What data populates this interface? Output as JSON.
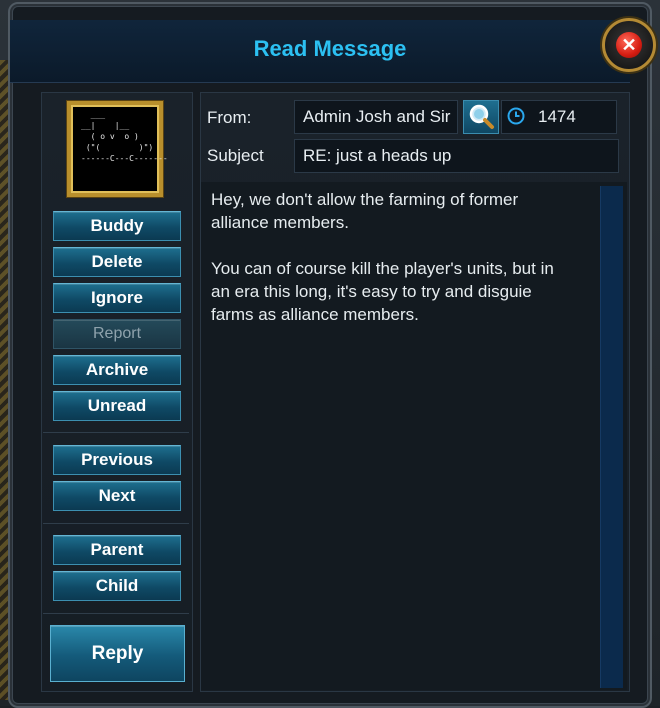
{
  "window": {
    "title": "Read Message"
  },
  "avatar": {
    "art": "  ___ \n__|    |__\n  ( o v  o )\n (\"(        )\")\n------C---C-------"
  },
  "actions": {
    "buddy": "Buddy",
    "delete": "Delete",
    "ignore": "Ignore",
    "report": "Report",
    "archive": "Archive",
    "unread": "Unread",
    "previous": "Previous",
    "next": "Next",
    "parent": "Parent",
    "child": "Child",
    "reply": "Reply"
  },
  "header": {
    "from_label": "From:",
    "from_value": "Admin Josh and Sir",
    "time_value": "1474",
    "subject_label": "Subject",
    "subject_value": "RE: just a heads up"
  },
  "message": {
    "body": "Hey, we don't allow the farming of former\nalliance members.\n\nYou can of course kill the player's units, but in\nan era this long, it's easy to try and disguie\nfarms as alliance members."
  },
  "colors": {
    "title": "#2cc0f2",
    "button": "#145a7a",
    "close": "#d61d12"
  },
  "icons": [
    "search-icon",
    "clock-icon",
    "close-icon"
  ]
}
